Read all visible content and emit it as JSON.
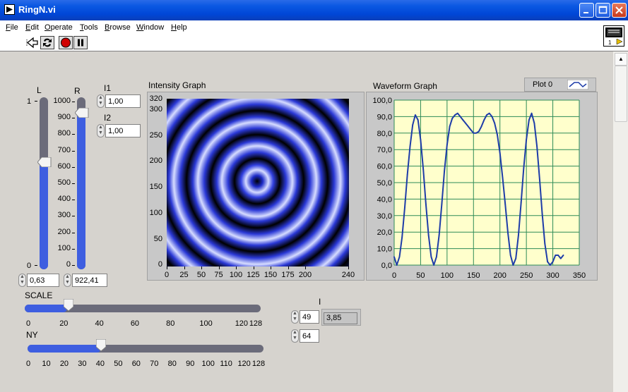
{
  "window": {
    "title": "RingN.vi"
  },
  "menu": [
    {
      "label": "File",
      "u": "F",
      "rest": "ile"
    },
    {
      "label": "Edit",
      "u": "E",
      "rest": "dit"
    },
    {
      "label": "Operate",
      "u": "O",
      "rest": "perate"
    },
    {
      "label": "Tools",
      "u": "T",
      "rest": "ools"
    },
    {
      "label": "Browse",
      "u": "B",
      "rest": "rowse"
    },
    {
      "label": "Window",
      "u": "W",
      "rest": "indow"
    },
    {
      "label": "Help",
      "u": "H",
      "rest": "elp"
    }
  ],
  "toolbar": {
    "icons": [
      "run-arrow-icon",
      "run-continuously-icon",
      "abort-icon",
      "pause-icon"
    ]
  },
  "vi_icon": {
    "label": "1"
  },
  "slider_L": {
    "label": "L",
    "ticks": [
      "1",
      "0"
    ],
    "value_text": "0,63",
    "value": 0.63
  },
  "slider_R": {
    "label": "R",
    "ticks": [
      "1000",
      "900",
      "800",
      "700",
      "600",
      "500",
      "400",
      "300",
      "200",
      "100",
      "0"
    ],
    "value_text": "922,41",
    "value": 922.41
  },
  "I1": {
    "label": "I1",
    "value": "1,00"
  },
  "I2": {
    "label": "I2",
    "value": "1,00"
  },
  "intensity_graph": {
    "title": "Intensity Graph",
    "y_ticks": [
      "320",
      "300",
      "250",
      "200",
      "150",
      "100",
      "50",
      "0"
    ],
    "x_ticks": [
      "0",
      "25",
      "50",
      "75",
      "100",
      "125",
      "150",
      "175",
      "200",
      "240"
    ]
  },
  "waveform_graph": {
    "title": "Waveform Graph",
    "legend": "Plot 0",
    "colors": {
      "plot_bg": "#ffffcc",
      "grid": "#2e8b57",
      "line": "#1e3ca8"
    }
  },
  "chart_data": {
    "type": "line",
    "title": "Waveform Graph",
    "xlabel": "",
    "ylabel": "",
    "xlim": [
      0,
      350
    ],
    "ylim": [
      0,
      100
    ],
    "x_ticks": [
      "0",
      "50",
      "100",
      "150",
      "200",
      "250",
      "300",
      "350"
    ],
    "y_ticks": [
      "100,0",
      "90,0",
      "80,0",
      "70,0",
      "60,0",
      "50,0",
      "40,0",
      "30,0",
      "20,0",
      "10,0",
      "0,0"
    ],
    "series": [
      {
        "name": "Plot 0",
        "x": [
          0,
          5,
          10,
          15,
          20,
          25,
          30,
          35,
          40,
          45,
          50,
          55,
          60,
          65,
          70,
          75,
          80,
          85,
          90,
          95,
          100,
          105,
          110,
          115,
          120,
          125,
          130,
          135,
          140,
          145,
          150,
          155,
          160,
          165,
          170,
          175,
          180,
          185,
          190,
          195,
          200,
          205,
          210,
          215,
          220,
          225,
          230,
          235,
          240,
          245,
          250,
          255,
          260,
          265,
          270,
          275,
          280,
          285,
          290,
          295,
          300,
          305,
          310,
          315,
          320
        ],
        "values": [
          5,
          0,
          5,
          17,
          35,
          55,
          72,
          85,
          91,
          88,
          76,
          58,
          37,
          18,
          5,
          0,
          5,
          18,
          37,
          57,
          73,
          84,
          89,
          91,
          92,
          90,
          88,
          86,
          84,
          82,
          80,
          80,
          81,
          84,
          88,
          91,
          92,
          90,
          86,
          79,
          68,
          53,
          37,
          20,
          6,
          0,
          4,
          18,
          38,
          59,
          76,
          88,
          92,
          86,
          72,
          52,
          31,
          13,
          2,
          0,
          2,
          6,
          6,
          4,
          6
        ]
      }
    ],
    "grid": true,
    "legend": "top-right"
  },
  "scale_slider": {
    "label": "SCALE",
    "ticks": [
      "0",
      "20",
      "40",
      "60",
      "80",
      "100",
      "120",
      "128"
    ],
    "value": 22
  },
  "ny_slider": {
    "label": "NY",
    "ticks": [
      "0",
      "10",
      "20",
      "30",
      "40",
      "50",
      "60",
      "70",
      "80",
      "90",
      "100",
      "110",
      "120",
      "128"
    ],
    "value": 40
  },
  "I_indicator": {
    "label": "I",
    "value": "3,85",
    "control_top": "49",
    "control_bottom": "64"
  }
}
